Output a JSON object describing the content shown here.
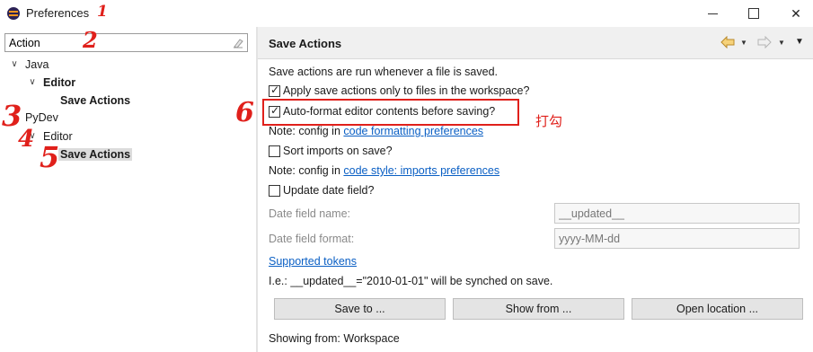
{
  "window": {
    "title": "Preferences",
    "icon": "eclipse-icon",
    "controls": [
      "minimize-icon",
      "maximize-icon",
      "close-icon"
    ]
  },
  "filter": {
    "value": "Action",
    "clear_icon": "eraser-icon"
  },
  "tree": {
    "java": "Java",
    "java_editor": "Editor",
    "java_save_actions": "Save Actions",
    "pydev": "PyDev",
    "pydev_editor": "Editor",
    "pydev_save_actions": "Save Actions"
  },
  "page": {
    "title": "Save Actions",
    "nav_icons": [
      "back-arrow-icon",
      "dropdown-icon",
      "forward-arrow-icon",
      "dropdown-icon",
      "view-menu-icon"
    ],
    "description": "Save actions are run whenever a file is saved.",
    "options": {
      "apply_only_workspace": {
        "label": "Apply save actions only to files in the workspace?",
        "checked": true
      },
      "auto_format": {
        "label": "Auto-format editor contents before saving?",
        "checked": true
      },
      "sort_imports": {
        "label": "Sort imports on save?",
        "checked": false
      },
      "update_date": {
        "label": "Update date field?",
        "checked": false
      }
    },
    "note_format_prefix": "Note: config in",
    "note_format_link": "code formatting preferences",
    "note_imports_prefix": "Note: config in",
    "note_imports_link": "code style: imports preferences",
    "date_field_name_label": "Date field name:",
    "date_field_name_value": "__updated__",
    "date_field_format_label": "Date field format:",
    "date_field_format_value": "yyyy-MM-dd",
    "supported_tokens_link": "Supported tokens",
    "example_text": "I.e.: __updated__=\"2010-01-01\" will be synched on save.",
    "buttons": {
      "save_to": "Save to ...",
      "show_from": "Show from ...",
      "open_location": "Open location ..."
    },
    "showing_from": "Showing from: Workspace"
  },
  "annotations": {
    "n1": "1",
    "n2": "2",
    "n3": "3",
    "n4": "4",
    "n5": "5",
    "n6": "6",
    "check_note": "打勾",
    "color": "#e0201b"
  }
}
